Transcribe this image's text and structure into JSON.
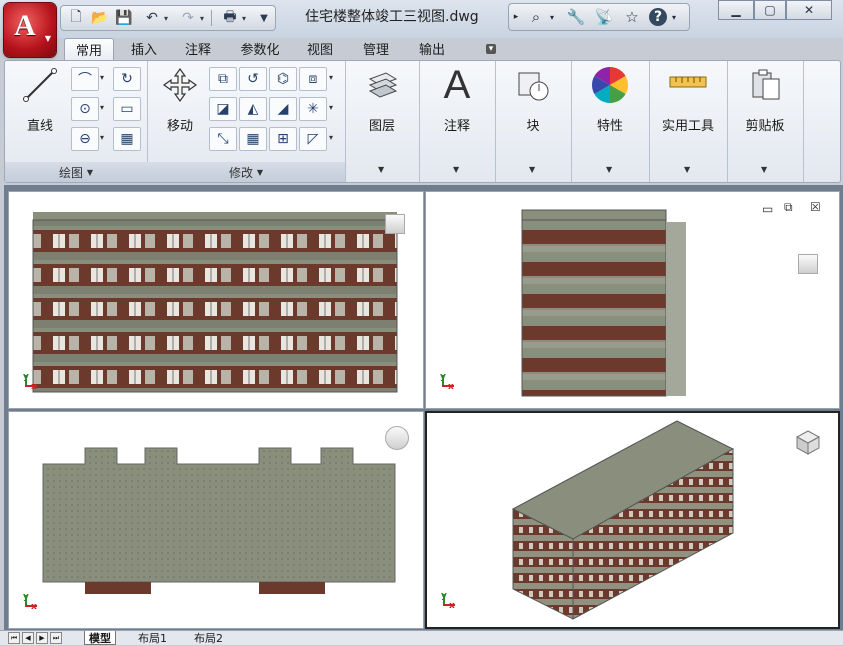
{
  "title_bar": {
    "app_button_glyph": "A",
    "document_title": "住宅楼整体竣工三视图.dwg"
  },
  "tabs": [
    {
      "label": "常用",
      "active": true
    },
    {
      "label": "插入"
    },
    {
      "label": "注释"
    },
    {
      "label": "参数化"
    },
    {
      "label": "视图"
    },
    {
      "label": "管理"
    },
    {
      "label": "输出"
    }
  ],
  "ribbon": {
    "draw_panel": {
      "label": "绘图",
      "line_label": "直线"
    },
    "modify_panel": {
      "label": "修改",
      "move_label": "移动"
    },
    "layers_label": "图层",
    "annotation_label": "注释",
    "annotation_glyph": "A",
    "block_label": "块",
    "properties_label": "特性",
    "utilities_label": "实用工具",
    "clipboard_label": "剪贴板"
  },
  "layout_tabs": [
    {
      "label": "模型",
      "active": true
    },
    {
      "label": "布局1"
    },
    {
      "label": "布局2"
    }
  ],
  "colors": {
    "app_red": "#b5121b",
    "ribbon_bg": "#eef2f7",
    "workspace_bg": "#6f7d8f",
    "roof_gray": "#8a8e7c",
    "brick_brown": "#6b3a2c"
  }
}
